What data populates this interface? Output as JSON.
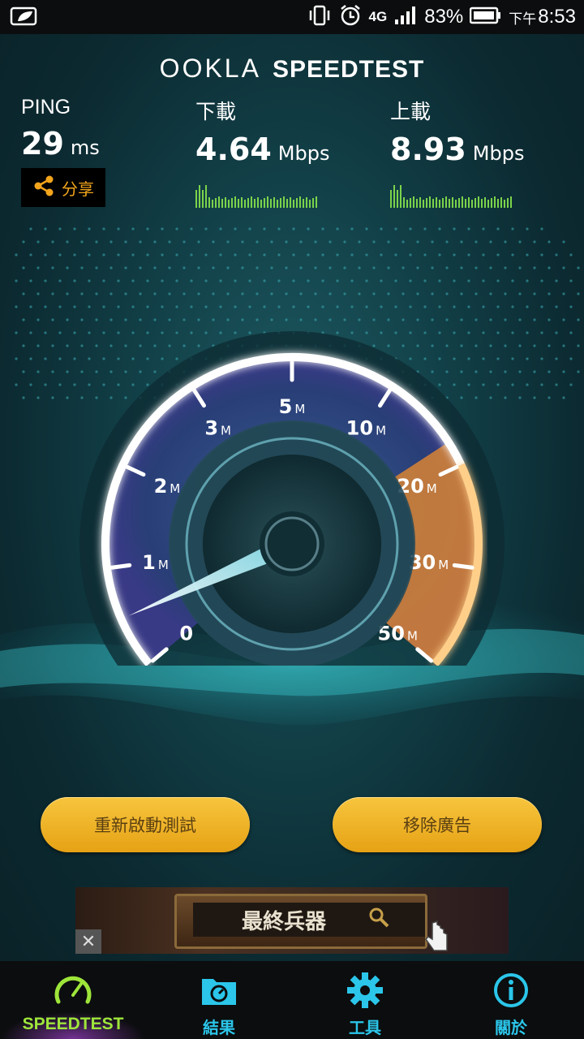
{
  "status_bar": {
    "battery_percent": "83%",
    "network": "4G",
    "time_prefix": "下午",
    "time": "8:53"
  },
  "brand": {
    "ookla": "OOKLA",
    "app": "SPEEDTEST"
  },
  "metrics": {
    "ping": {
      "label": "PING",
      "value": "29",
      "unit": "ms"
    },
    "download": {
      "label": "下載",
      "value": "4.64",
      "unit": "Mbps"
    },
    "upload": {
      "label": "上載",
      "value": "8.93",
      "unit": "Mbps"
    }
  },
  "share": {
    "label": "分享"
  },
  "gauge": {
    "ticks": [
      {
        "num": "0",
        "suffix": ""
      },
      {
        "num": "1",
        "suffix": "M"
      },
      {
        "num": "2",
        "suffix": "M"
      },
      {
        "num": "3",
        "suffix": "M"
      },
      {
        "num": "5",
        "suffix": "M"
      },
      {
        "num": "10",
        "suffix": "M"
      },
      {
        "num": "20",
        "suffix": "M"
      },
      {
        "num": "30",
        "suffix": "M"
      },
      {
        "num": "50",
        "suffix": "M"
      }
    ],
    "needle_value_mbps": 0.5
  },
  "buttons": {
    "restart": "重新啟動測試",
    "remove_ads": "移除廣告"
  },
  "ad": {
    "text": "最終兵器",
    "close": "✕"
  },
  "nav": {
    "items": [
      {
        "label": "SPEEDTEST",
        "icon": "speedometer-icon",
        "active": true
      },
      {
        "label": "結果",
        "icon": "results-folder-icon",
        "active": false
      },
      {
        "label": "工具",
        "icon": "gear-icon",
        "active": false
      },
      {
        "label": "關於",
        "icon": "info-icon",
        "active": false
      }
    ]
  },
  "colors": {
    "accent_orange": "#f3a51c",
    "nav_blue": "#2bc6ea",
    "nav_active_green": "#9ee53a",
    "button_gold": "#e6a215"
  }
}
